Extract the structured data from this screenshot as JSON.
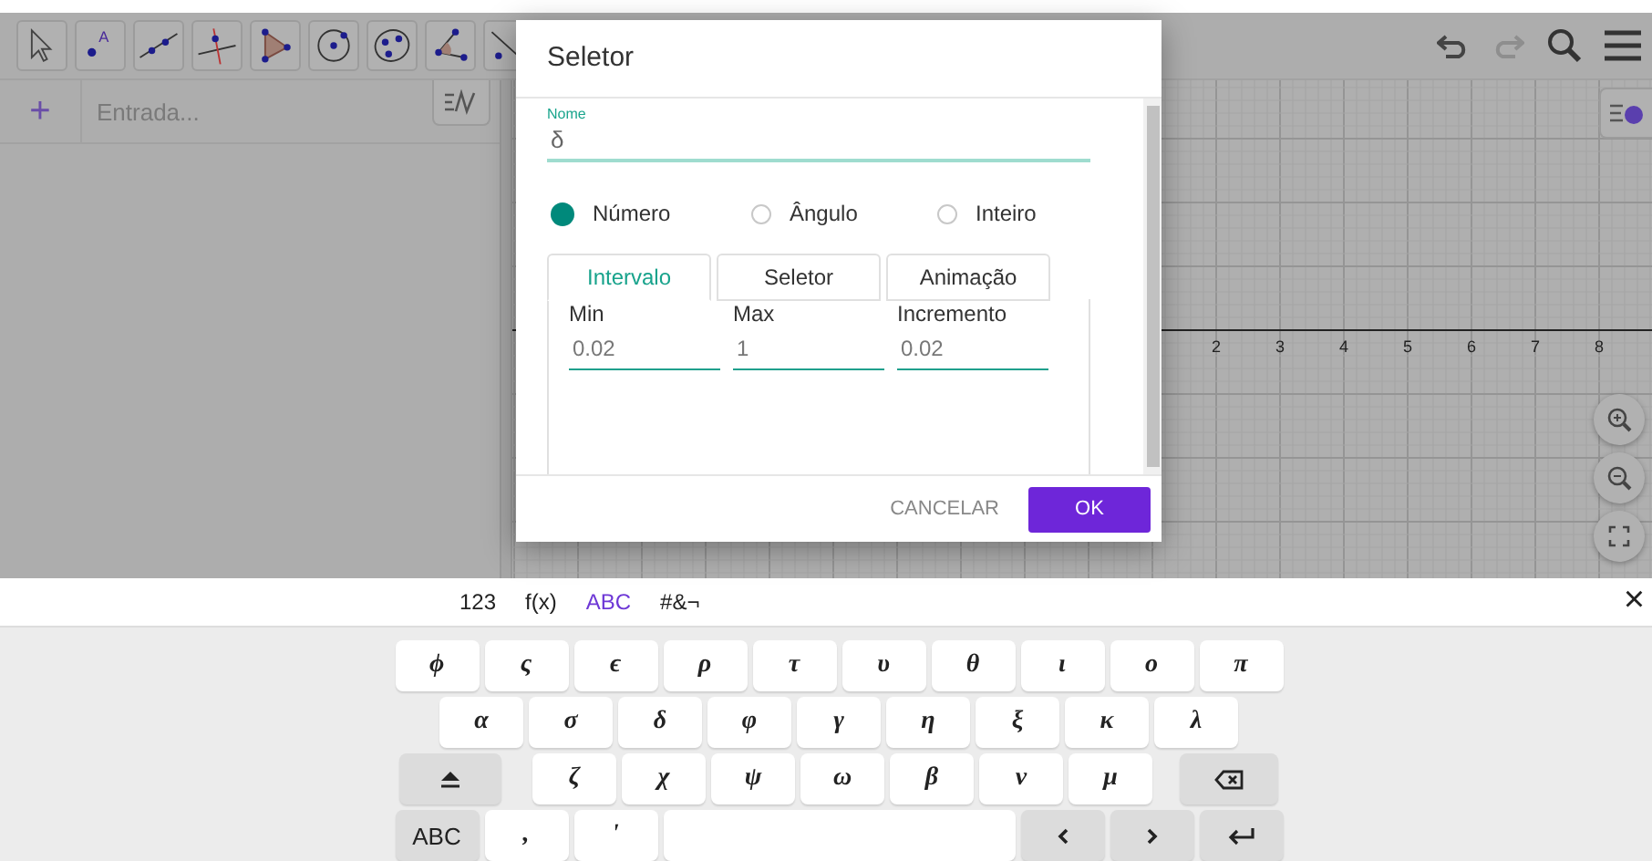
{
  "toolbar": {
    "tools": [
      {
        "kind": "move"
      },
      {
        "kind": "point",
        "label": "A"
      },
      {
        "kind": "line"
      },
      {
        "kind": "perpendicular"
      },
      {
        "kind": "polygon"
      },
      {
        "kind": "circle"
      },
      {
        "kind": "conic"
      },
      {
        "kind": "angle"
      },
      {
        "kind": "slider"
      }
    ],
    "actions": [
      {
        "kind": "undo",
        "disabled": false
      },
      {
        "kind": "redo",
        "disabled": true
      },
      {
        "kind": "search"
      },
      {
        "kind": "menu"
      }
    ]
  },
  "algebra": {
    "add": "+",
    "input": {
      "placeholder": "Entrada..."
    }
  },
  "graphics": {
    "x_axis_labels": [
      "2",
      "3",
      "4",
      "5",
      "6",
      "7",
      "8"
    ],
    "zoom_buttons": [
      {
        "kind": "zoom-in"
      },
      {
        "kind": "zoom-out"
      },
      {
        "kind": "fullscreen"
      }
    ]
  },
  "dialog": {
    "title": "Seletor",
    "name_field": {
      "label": "Nome",
      "value": "δ"
    },
    "type_options": [
      {
        "label": "Número",
        "selected": true
      },
      {
        "label": "Ângulo",
        "selected": false
      },
      {
        "label": "Inteiro",
        "selected": false
      }
    ],
    "tabs": [
      {
        "label": "Intervalo",
        "selected": true
      },
      {
        "label": "Seletor",
        "selected": false
      },
      {
        "label": "Animação",
        "selected": false
      }
    ],
    "fields": [
      {
        "label": "Min",
        "value": "0.02"
      },
      {
        "label": "Max",
        "value": "1"
      },
      {
        "label": "Incremento",
        "value": "0.02"
      }
    ],
    "buttons": [
      {
        "kind": "text",
        "label": "CANCELAR"
      },
      {
        "kind": "primary",
        "label": "OK"
      }
    ]
  },
  "keyboard": {
    "tabs": [
      {
        "label": "123",
        "selected": false
      },
      {
        "label": "f(x)",
        "selected": false
      },
      {
        "label": "ABC",
        "selected": true
      },
      {
        "label": "#&¬",
        "selected": false
      }
    ],
    "close": "×",
    "rows": [
      [
        {
          "kind": "char",
          "label": "ϕ"
        },
        {
          "kind": "char",
          "label": "ς"
        },
        {
          "kind": "char",
          "label": "ϵ"
        },
        {
          "kind": "char",
          "label": "ρ"
        },
        {
          "kind": "char",
          "label": "τ"
        },
        {
          "kind": "char",
          "label": "υ"
        },
        {
          "kind": "char",
          "label": "θ"
        },
        {
          "kind": "char",
          "label": "ι"
        },
        {
          "kind": "char",
          "label": "ο"
        },
        {
          "kind": "char",
          "label": "π"
        }
      ],
      [
        {
          "kind": "char",
          "label": "α"
        },
        {
          "kind": "char",
          "label": "σ"
        },
        {
          "kind": "char",
          "label": "δ"
        },
        {
          "kind": "char",
          "label": "φ"
        },
        {
          "kind": "char",
          "label": "γ"
        },
        {
          "kind": "char",
          "label": "η"
        },
        {
          "kind": "char",
          "label": "ξ"
        },
        {
          "kind": "char",
          "label": "κ"
        },
        {
          "kind": "char",
          "label": "λ"
        }
      ],
      [
        {
          "kind": "shift"
        },
        {
          "kind": "char",
          "label": "ζ"
        },
        {
          "kind": "char",
          "label": "χ"
        },
        {
          "kind": "char",
          "label": "ψ"
        },
        {
          "kind": "char",
          "label": "ω"
        },
        {
          "kind": "char",
          "label": "β"
        },
        {
          "kind": "char",
          "label": "ν"
        },
        {
          "kind": "char",
          "label": "μ"
        },
        {
          "kind": "backspace"
        }
      ],
      [
        {
          "kind": "mode",
          "label": "ABC"
        },
        {
          "kind": "char",
          "label": ","
        },
        {
          "kind": "char",
          "label": "'"
        },
        {
          "kind": "space"
        },
        {
          "kind": "left"
        },
        {
          "kind": "right"
        },
        {
          "kind": "enter"
        }
      ]
    ]
  }
}
